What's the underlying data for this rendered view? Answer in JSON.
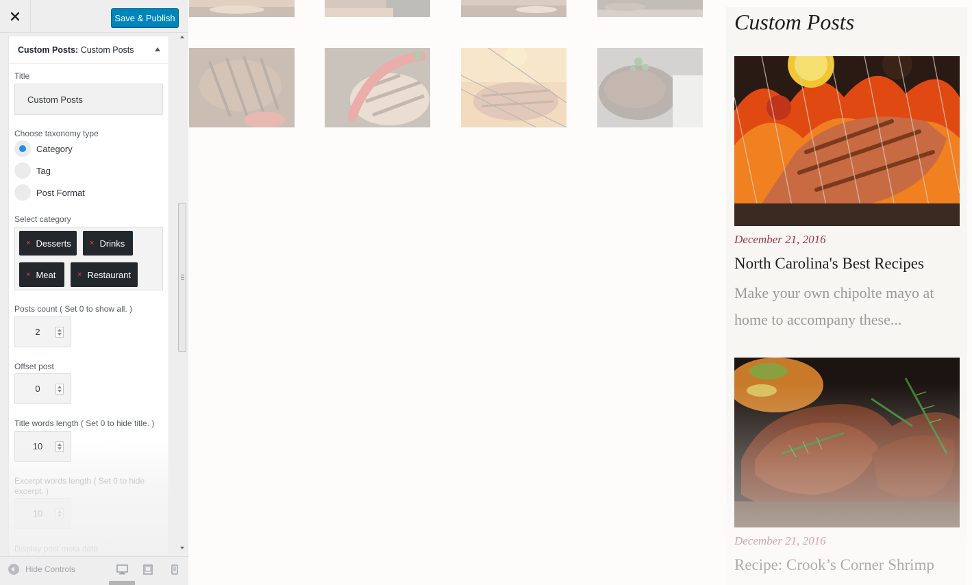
{
  "header": {
    "close_icon": "close-icon",
    "publish_label": "Save & Publish"
  },
  "widget": {
    "head_prefix": "Custom Posts:",
    "head_name": "Custom Posts",
    "title_label": "Title",
    "title_value": "Custom Posts",
    "taxonomy_label": "Choose taxonomy type",
    "taxonomy_options": [
      {
        "label": "Category",
        "checked": true
      },
      {
        "label": "Tag",
        "checked": false
      },
      {
        "label": "Post Format",
        "checked": false
      }
    ],
    "category_label": "Select category",
    "categories": [
      "Desserts",
      "Drinks",
      "Meat",
      "Restaurant"
    ],
    "remove_glyph": "×",
    "posts_count_label": "Posts count ( Set 0 to show all. )",
    "posts_count_value": "2",
    "offset_label": "Offset post",
    "offset_value": "0",
    "title_words_label": "Title words length ( Set 0 to hide title. )",
    "title_words_value": "10",
    "excerpt_words_label": "Excerpt words length ( Set 0 to hide excerpt. )",
    "excerpt_words_value": "10",
    "meta_label": "Display post meta data"
  },
  "footer": {
    "hide_controls_label": "Hide Controls",
    "devices": [
      "desktop-icon",
      "tablet-icon",
      "mobile-icon"
    ]
  },
  "preview": {
    "widget_title": "Custom Posts",
    "posts": [
      {
        "date": "December 21, 2016",
        "title": "North Carolina's Best Recipes",
        "excerpt": "Make your own chipolte mayo at home to accompany these..."
      },
      {
        "date": "December 21, 2016",
        "title": "Recipe: Crook’s Corner Shrimp",
        "excerpt": ""
      }
    ]
  },
  "colors": {
    "accent": "#0085ba",
    "date": "#a1363e",
    "radio_checked": "#1e8cf0",
    "tag_bg": "#23282d",
    "tag_remove": "#e0484d"
  }
}
